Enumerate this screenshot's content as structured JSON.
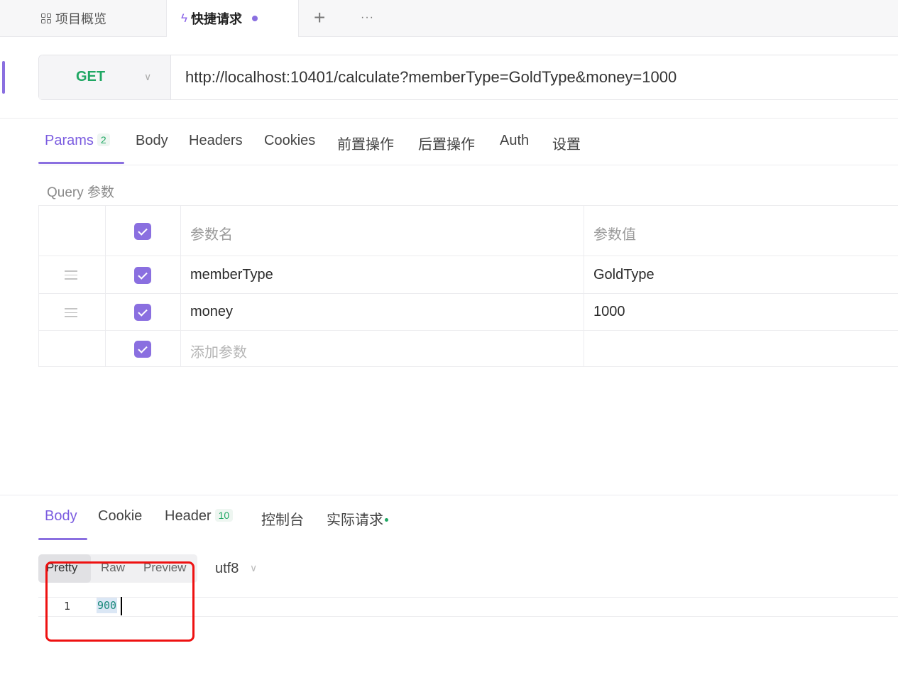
{
  "tabs": {
    "overview": "项目概览",
    "quick_request": "快捷请求",
    "plus": "+",
    "more": "···"
  },
  "request": {
    "method": "GET",
    "url": "http://localhost:10401/calculate?memberType=GoldType&money=1000"
  },
  "request_tabs": [
    {
      "label": "Params",
      "badge": "2"
    },
    {
      "label": "Body"
    },
    {
      "label": "Headers"
    },
    {
      "label": "Cookies"
    },
    {
      "label": "前置操作"
    },
    {
      "label": "后置操作"
    },
    {
      "label": "Auth"
    },
    {
      "label": "设置"
    }
  ],
  "query": {
    "section_label": "Query 参数",
    "header": {
      "name": "参数名",
      "value": "参数值"
    },
    "rows": [
      {
        "name": "memberType",
        "value": "GoldType",
        "checked": true
      },
      {
        "name": "money",
        "value": "1000",
        "checked": true
      }
    ],
    "add_placeholder": "添加参数"
  },
  "response": {
    "tabs": [
      {
        "label": "Body"
      },
      {
        "label": "Cookie"
      },
      {
        "label": "Header",
        "badge": "10"
      },
      {
        "label": "控制台"
      },
      {
        "label": "实际请求"
      }
    ],
    "formats": [
      "Pretty",
      "Raw",
      "Preview"
    ],
    "encoding": "utf8",
    "lines": [
      {
        "number": "1",
        "text": "900"
      }
    ]
  },
  "colors": {
    "accent": "#8a6fe0",
    "method_get": "#1fa763",
    "highlight": "#ee1111"
  }
}
